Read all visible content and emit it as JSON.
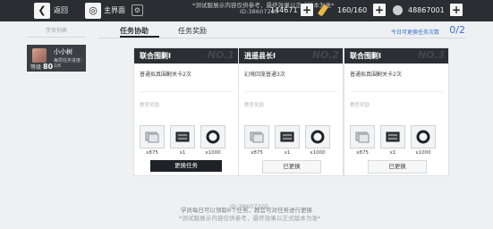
{
  "topbar": {
    "back_label": "返回",
    "home_label": "主界面",
    "watermark": "*测试服展示内容仅供参考，最终效果以正式版本为准*",
    "user_id": "ID:38607205",
    "resources": [
      {
        "name": "gold",
        "value": "144671",
        "icon_color": "#e9b845"
      },
      {
        "name": "stamina",
        "value": "160/160",
        "icon_color": "#6fb3e8"
      },
      {
        "name": "currency",
        "value": "48867001",
        "icon_color": "#cfcfcf"
      }
    ]
  },
  "sidebar": {
    "title": "学员列表",
    "student": {
      "name": "小小树",
      "progress": "每周任务进度：2/6",
      "level_prefix": "等级",
      "level": "80"
    }
  },
  "tabs": [
    {
      "label": "任务协助",
      "active": true
    },
    {
      "label": "任务奖励",
      "active": false
    }
  ],
  "refresh": {
    "label": "今日可更换任务次数",
    "count": "0/2"
  },
  "cards": [
    {
      "title": "联合围剿Ⅰ",
      "badge": "NO.1",
      "desc": "普通拟真围剿关卡2次",
      "reward_label": "教官奖励",
      "rewards": [
        {
          "name": "manual-icon",
          "qty": "x875"
        },
        {
          "name": "chip-icon",
          "qty": "x1"
        },
        {
          "name": "ring-icon",
          "qty": "x1000"
        }
      ],
      "button": "更换任务",
      "button_state": "active"
    },
    {
      "title": "逍遥县长Ⅰ",
      "badge": "NO.2",
      "desc": "幻境囚笼普通3次",
      "reward_label": "教官奖励",
      "rewards": [
        {
          "name": "manual-icon",
          "qty": "x875"
        },
        {
          "name": "chip-icon",
          "qty": "x1"
        },
        {
          "name": "ring-icon",
          "qty": "x1000"
        }
      ],
      "button": "已更换",
      "button_state": "done"
    },
    {
      "title": "联合围剿Ⅰ",
      "badge": "NO.3",
      "desc": "普通拟真围剿关卡2次",
      "reward_label": "教官奖励",
      "rewards": [
        {
          "name": "manual-icon",
          "qty": "x875"
        },
        {
          "name": "chip-icon",
          "qty": "x1"
        },
        {
          "name": "ring-icon",
          "qty": "x1000"
        }
      ],
      "button": "已更换",
      "button_state": "done"
    }
  ],
  "footer": {
    "note": "学员每日可以领取6个任务，教官可对任务进行更换",
    "watermark": "*测试服展示内容仅供参考，最终效果以正式版本为准*",
    "user_id": "ID:38607205"
  }
}
